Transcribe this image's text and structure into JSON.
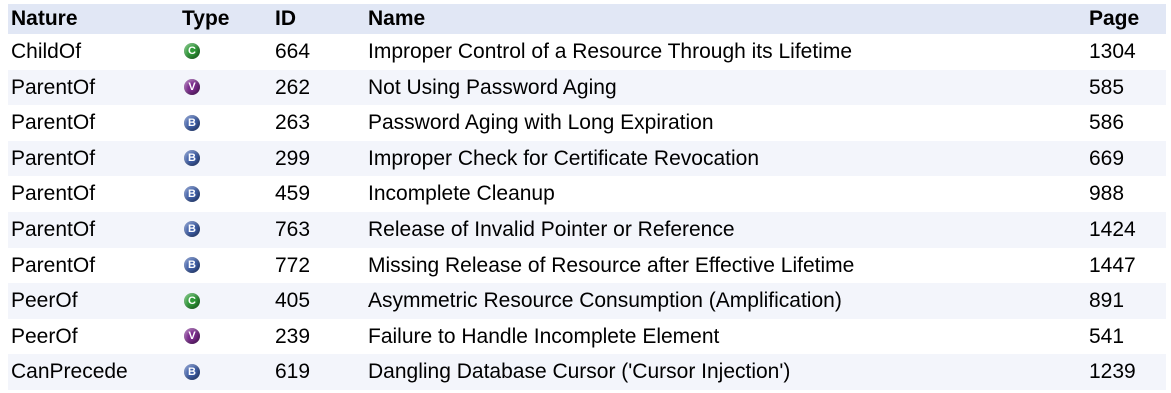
{
  "table": {
    "headers": {
      "nature": "Nature",
      "type": "Type",
      "id": "ID",
      "name": "Name",
      "page": "Page"
    },
    "rows": [
      {
        "nature": "ChildOf",
        "type_letter": "C",
        "type_icon": "category-icon",
        "id": "664",
        "name": "Improper Control of a Resource Through its Lifetime",
        "page": "1304"
      },
      {
        "nature": "ParentOf",
        "type_letter": "V",
        "type_icon": "variant-icon",
        "id": "262",
        "name": "Not Using Password Aging",
        "page": "585"
      },
      {
        "nature": "ParentOf",
        "type_letter": "B",
        "type_icon": "base-icon",
        "id": "263",
        "name": "Password Aging with Long Expiration",
        "page": "586"
      },
      {
        "nature": "ParentOf",
        "type_letter": "B",
        "type_icon": "base-icon",
        "id": "299",
        "name": "Improper Check for Certificate Revocation",
        "page": "669"
      },
      {
        "nature": "ParentOf",
        "type_letter": "B",
        "type_icon": "base-icon",
        "id": "459",
        "name": "Incomplete Cleanup",
        "page": "988"
      },
      {
        "nature": "ParentOf",
        "type_letter": "B",
        "type_icon": "base-icon",
        "id": "763",
        "name": "Release of Invalid Pointer or Reference",
        "page": "1424"
      },
      {
        "nature": "ParentOf",
        "type_letter": "B",
        "type_icon": "base-icon",
        "id": "772",
        "name": "Missing Release of Resource after Effective Lifetime",
        "page": "1447"
      },
      {
        "nature": "PeerOf",
        "type_letter": "C",
        "type_icon": "category-icon",
        "id": "405",
        "name": "Asymmetric Resource Consumption (Amplification)",
        "page": "891"
      },
      {
        "nature": "PeerOf",
        "type_letter": "V",
        "type_icon": "variant-icon",
        "id": "239",
        "name": "Failure to Handle Incomplete Element",
        "page": "541"
      },
      {
        "nature": "CanPrecede",
        "type_letter": "B",
        "type_icon": "base-icon",
        "id": "619",
        "name": "Dangling Database Cursor ('Cursor Injection')",
        "page": "1239"
      }
    ]
  },
  "colors": {
    "header_bg": "#e1e7f5",
    "row_alt_bg": "#f3f5fb",
    "category": "#2f9a38",
    "variant": "#7a2a8c",
    "base": "#3f5fa8"
  }
}
